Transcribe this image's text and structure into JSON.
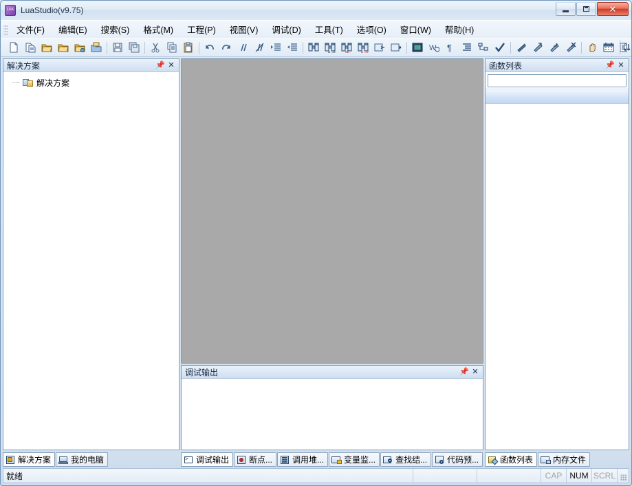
{
  "window": {
    "title": "LuaStudio(v9.75)",
    "icon": "lua-app-icon",
    "minimize_label": "",
    "maximize_label": "",
    "close_label": "✕"
  },
  "menubar": {
    "items": [
      {
        "label": "文件(F)",
        "name": "menu-file"
      },
      {
        "label": "编辑(E)",
        "name": "menu-edit"
      },
      {
        "label": "搜索(S)",
        "name": "menu-search"
      },
      {
        "label": "格式(M)",
        "name": "menu-format"
      },
      {
        "label": "工程(P)",
        "name": "menu-project"
      },
      {
        "label": "视图(V)",
        "name": "menu-view"
      },
      {
        "label": "调试(D)",
        "name": "menu-debug"
      },
      {
        "label": "工具(T)",
        "name": "menu-tools"
      },
      {
        "label": "选项(O)",
        "name": "menu-options"
      },
      {
        "label": "窗口(W)",
        "name": "menu-window"
      },
      {
        "label": "帮助(H)",
        "name": "menu-help"
      }
    ]
  },
  "toolbar": {
    "overflow_label": "»",
    "buttons": [
      {
        "name": "new-file-icon",
        "glyph": "□",
        "kind": "page"
      },
      {
        "name": "new-from-template-icon",
        "glyph": "▤",
        "kind": "page2"
      },
      {
        "name": "open-file-icon",
        "glyph": "▱",
        "kind": "folder"
      },
      {
        "name": "open-project-icon",
        "glyph": "▱",
        "kind": "folder2"
      },
      {
        "name": "open-recent-icon",
        "glyph": "▱",
        "kind": "folderstar"
      },
      {
        "name": "new-project-icon",
        "glyph": "▱",
        "kind": "folderblue"
      },
      {
        "sep": true
      },
      {
        "name": "save-icon",
        "glyph": "■",
        "kind": "save"
      },
      {
        "name": "save-all-icon",
        "glyph": "■",
        "kind": "saveall"
      },
      {
        "sep": true
      },
      {
        "name": "cut-icon",
        "glyph": "✂",
        "kind": "cut"
      },
      {
        "name": "copy-icon",
        "glyph": "⧉",
        "kind": "copy"
      },
      {
        "name": "paste-icon",
        "glyph": "Ὄb",
        "kind": "paste"
      },
      {
        "sep": true
      },
      {
        "name": "undo-icon",
        "glyph": "↶",
        "kind": "undo"
      },
      {
        "name": "redo-icon",
        "glyph": "↷",
        "kind": "redo"
      },
      {
        "name": "comment-line-icon",
        "glyph": "//",
        "kind": "comment"
      },
      {
        "name": "uncomment-line-icon",
        "glyph": "//",
        "kind": "uncomment"
      },
      {
        "name": "indent-icon",
        "glyph": "⇥",
        "kind": "indent"
      },
      {
        "name": "outdent-icon",
        "glyph": "⇤",
        "kind": "outdent"
      },
      {
        "sep": true
      },
      {
        "name": "find-icon",
        "glyph": "ὐd",
        "kind": "binoc"
      },
      {
        "name": "replace-icon",
        "glyph": "ὐd",
        "kind": "binoc2"
      },
      {
        "name": "find-in-files-icon",
        "glyph": "ὐd",
        "kind": "binoc3"
      },
      {
        "name": "replace-in-files-icon",
        "glyph": "ὐd",
        "kind": "binoc4"
      },
      {
        "name": "goto-line-icon",
        "glyph": "⮌",
        "kind": "goto"
      },
      {
        "name": "bookmark-icon",
        "glyph": "⮌",
        "kind": "bookmark"
      },
      {
        "sep": true
      },
      {
        "name": "toggle-grid-icon",
        "glyph": "▦",
        "kind": "grid"
      },
      {
        "name": "wrap-text-icon",
        "glyph": "W",
        "kind": "wrap"
      },
      {
        "name": "show-whitespace-icon",
        "glyph": "¶",
        "kind": "pilcrow"
      },
      {
        "name": "format-code-icon",
        "glyph": "≡",
        "kind": "format"
      },
      {
        "name": "outline-icon",
        "glyph": "⌸",
        "kind": "outline"
      },
      {
        "name": "check-syntax-icon",
        "glyph": "✓",
        "kind": "check"
      },
      {
        "sep": true
      },
      {
        "name": "run-icon",
        "glyph": "▶",
        "kind": "run"
      },
      {
        "name": "step-over-icon",
        "glyph": "↷",
        "kind": "stepover"
      },
      {
        "name": "step-into-icon",
        "glyph": "↷",
        "kind": "stepinto"
      },
      {
        "name": "stop-debug-icon",
        "glyph": "↷",
        "kind": "stopdebug"
      },
      {
        "sep": true
      },
      {
        "name": "pan-tool-icon",
        "glyph": "✋",
        "kind": "hand"
      },
      {
        "name": "calendar-icon",
        "glyph": "▦",
        "kind": "calendar"
      },
      {
        "name": "sort-list-icon",
        "glyph": "≡",
        "kind": "sort"
      }
    ]
  },
  "left_panel": {
    "caption": "解决方案",
    "pin_label": "➤",
    "close_label": "✕",
    "tree": [
      {
        "label": "解决方案",
        "icon": "solution-folder-icon"
      }
    ]
  },
  "right_panel": {
    "caption": "函数列表",
    "pin_label": "➤",
    "close_label": "✕",
    "search_value": "",
    "search_placeholder": ""
  },
  "output_panel": {
    "caption": "调试输出",
    "pin_label": "➤",
    "close_label": "✕",
    "content": ""
  },
  "editor": {
    "background_color": "#a9a9a9",
    "content": ""
  },
  "tabs": {
    "left": [
      {
        "label": "解决方案",
        "icon": "ti-sol",
        "name": "tab-solution",
        "active": true
      },
      {
        "label": "我的电脑",
        "icon": "ti-pc",
        "name": "tab-my-computer",
        "active": false
      }
    ],
    "center": [
      {
        "label": "调试输出",
        "icon": "ti-out",
        "name": "tab-debug-output",
        "active": true
      },
      {
        "label": "断点...",
        "icon": "ti-bp",
        "name": "tab-breakpoints",
        "active": false
      },
      {
        "label": "调用堆...",
        "icon": "ti-stack",
        "name": "tab-call-stack",
        "active": false
      },
      {
        "label": "变量监...",
        "icon": "ti-watch",
        "name": "tab-watch",
        "active": false
      },
      {
        "label": "查找结...",
        "icon": "ti-find",
        "name": "tab-find-results",
        "active": false
      },
      {
        "label": "代码预...",
        "icon": "ti-prev",
        "name": "tab-code-preview",
        "active": false
      }
    ],
    "right": [
      {
        "label": "函数列表",
        "icon": "ti-func",
        "name": "tab-function-list",
        "active": true
      },
      {
        "label": "内存文件",
        "icon": "ti-mem",
        "name": "tab-memory-file",
        "active": false
      }
    ]
  },
  "statusbar": {
    "message": "就绪",
    "indicators": [
      {
        "label": "CAP",
        "active": false,
        "name": "status-caps-lock"
      },
      {
        "label": "NUM",
        "active": true,
        "name": "status-num-lock"
      },
      {
        "label": "SCRL",
        "active": false,
        "name": "status-scroll-lock"
      }
    ]
  },
  "colors": {
    "window_frame": "#6f94bc",
    "panel_border": "#7f9db9",
    "editor_gray": "#a9a9a9",
    "caption_gradient_top": "#eaf2fa",
    "selection_blue": "#c3d8f2",
    "close_button_red": "#cf3c24"
  }
}
